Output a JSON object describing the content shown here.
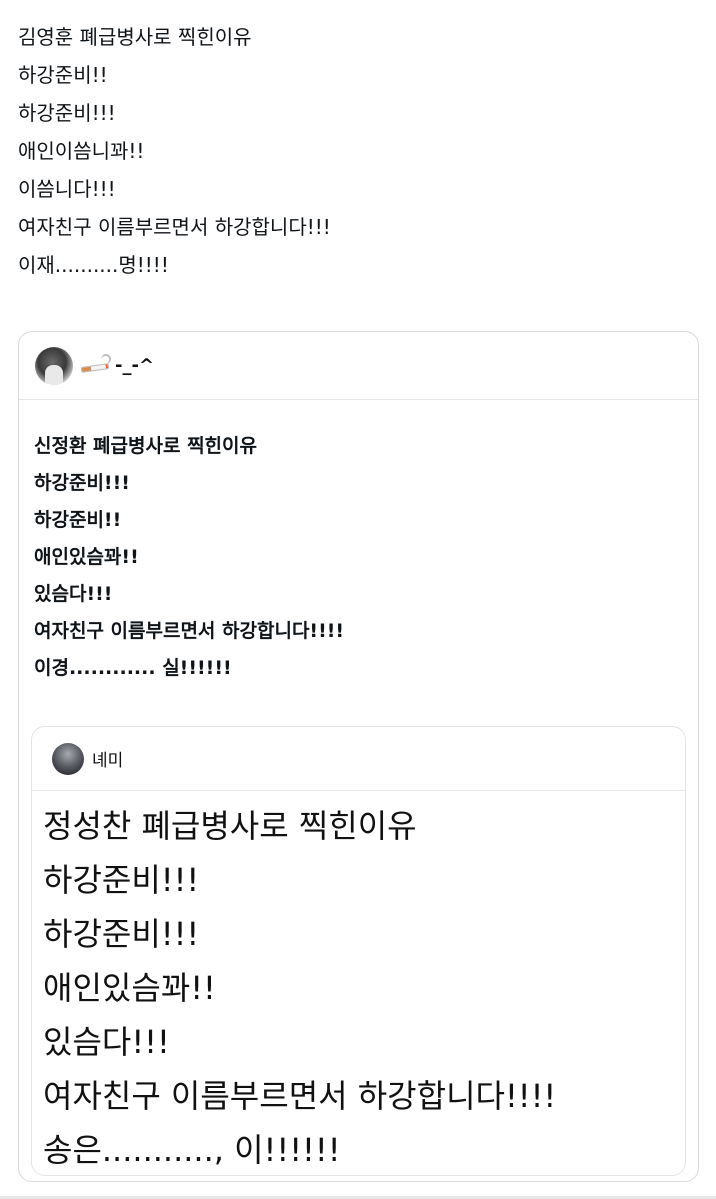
{
  "main_post": {
    "lines": [
      "김영훈 폐급병사로 찍힌이유",
      "하강준비!!",
      "하강준비!!!",
      "애인이씀니꽈!!",
      "이씀니다!!!",
      "여자친구 이름부르면서 하강합니다!!!",
      "이재..........명!!!!"
    ]
  },
  "quote1": {
    "user_name": "-_-^",
    "avatar_icon": "profile-photo",
    "badge_icon": "cigarette-emoji",
    "lines": [
      "신정환 폐급병사로 찍힌이유",
      "하강준비!!!",
      "하강준비!!",
      "애인있슴꽈!!",
      "있슴다!!!",
      "여자친구 이름부르면서 하강합니다!!!!",
      "이경............ 실!!!!!!"
    ]
  },
  "quote2": {
    "user_name": "녜미",
    "avatar_icon": "profile-photo",
    "lines": [
      "정성찬 폐급병사로 찍힌이유",
      "하강준비!!!",
      "하강준비!!!",
      "애인있슴꽈!!",
      "있슴다!!!",
      "여자친구 이름부르면서 하강합니다!!!!",
      "송은..........., 이!!!!!!"
    ]
  }
}
